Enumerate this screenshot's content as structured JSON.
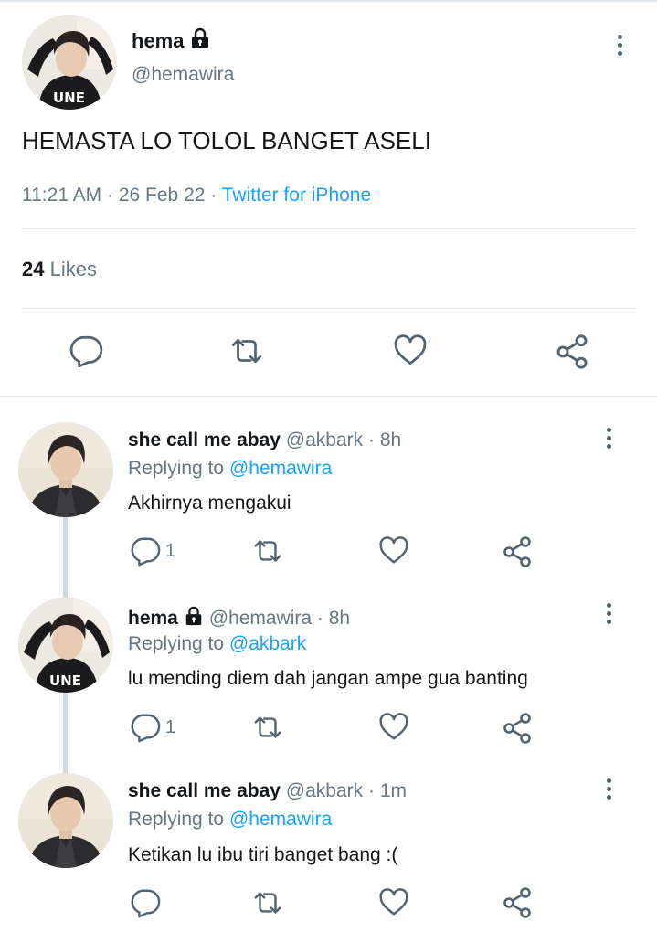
{
  "main_tweet": {
    "name": "hema",
    "handle": "@hemawira",
    "text": "HEMASTA LO TOLOL BANGET ASELI",
    "time": "11:21 AM",
    "date": "26 Feb 22",
    "dot": "·",
    "source": "Twitter for iPhone",
    "likes_count": "24",
    "likes_label": "Likes"
  },
  "replies": [
    {
      "name": "she call me abay",
      "handle": "@akbark",
      "time_sep": "·",
      "time": "8h",
      "replying_label": "Replying to",
      "replying_to": "@hemawira",
      "text": "Akhirnya mengakui",
      "reply_count": "1"
    },
    {
      "name": "hema",
      "handle": "@hemawira",
      "time_sep": "·",
      "time": "8h",
      "replying_label": "Replying to",
      "replying_to": "@akbark",
      "text": "lu mending diem dah jangan ampe gua banting",
      "reply_count": "1"
    },
    {
      "name": "she call me abay",
      "handle": "@akbark",
      "time_sep": "·",
      "time": "1m",
      "replying_label": "Replying to",
      "replying_to": "@hemawira",
      "text": "Ketikan lu ibu tiri banget bang :(",
      "reply_count": ""
    }
  ],
  "colors": {
    "accent": "#1da1f2",
    "secondary_text": "#657786",
    "primary_text": "#14171a",
    "icon": "#536471",
    "divider": "#e1e6ea"
  },
  "icons": {
    "lock": "lock-icon",
    "more": "more-vertical-icon",
    "reply": "reply-icon",
    "retweet": "retweet-icon",
    "like": "heart-icon",
    "share": "share-icon"
  }
}
